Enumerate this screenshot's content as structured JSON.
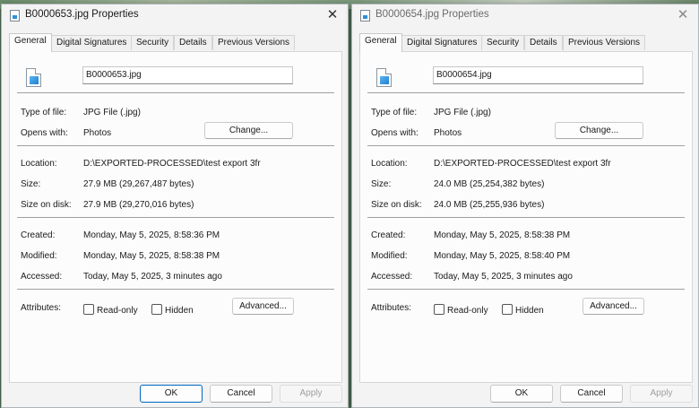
{
  "dialogs": [
    {
      "title": "B0000653.jpg Properties",
      "tabs": [
        "General",
        "Digital Signatures",
        "Security",
        "Details",
        "Previous Versions"
      ],
      "filename": "B0000653.jpg",
      "type_label": "Type of file:",
      "type_value": "JPG File (.jpg)",
      "opens_label": "Opens with:",
      "opens_value": "Photos",
      "change_label": "Change...",
      "location_label": "Location:",
      "location_value": "D:\\EXPORTED-PROCESSED\\test export 3fr",
      "size_label": "Size:",
      "size_value": "27.9 MB (29,267,487 bytes)",
      "size_disk_label": "Size on disk:",
      "size_disk_value": "27.9 MB (29,270,016 bytes)",
      "created_label": "Created:",
      "created_value": "Monday, May 5, 2025, 8:58:36 PM",
      "modified_label": "Modified:",
      "modified_value": "Monday, May 5, 2025, 8:58:38 PM",
      "accessed_label": "Accessed:",
      "accessed_value": "Today, May 5, 2025, 3 minutes ago",
      "attributes_label": "Attributes:",
      "readonly_label": "Read-only",
      "hidden_label": "Hidden",
      "advanced_label": "Advanced...",
      "ok_label": "OK",
      "cancel_label": "Cancel",
      "apply_label": "Apply",
      "close_glyph": "✕"
    },
    {
      "title": "B0000654.jpg Properties",
      "tabs": [
        "General",
        "Digital Signatures",
        "Security",
        "Details",
        "Previous Versions"
      ],
      "filename": "B0000654.jpg",
      "type_label": "Type of file:",
      "type_value": "JPG File (.jpg)",
      "opens_label": "Opens with:",
      "opens_value": "Photos",
      "change_label": "Change...",
      "location_label": "Location:",
      "location_value": "D:\\EXPORTED-PROCESSED\\test export 3fr",
      "size_label": "Size:",
      "size_value": "24.0 MB (25,254,382 bytes)",
      "size_disk_label": "Size on disk:",
      "size_disk_value": "24.0 MB (25,255,936 bytes)",
      "created_label": "Created:",
      "created_value": "Monday, May 5, 2025, 8:58:38 PM",
      "modified_label": "Modified:",
      "modified_value": "Monday, May 5, 2025, 8:58:40 PM",
      "accessed_label": "Accessed:",
      "accessed_value": "Today, May 5, 2025, 3 minutes ago",
      "attributes_label": "Attributes:",
      "readonly_label": "Read-only",
      "hidden_label": "Hidden",
      "advanced_label": "Advanced...",
      "ok_label": "OK",
      "cancel_label": "Cancel",
      "apply_label": "Apply",
      "close_glyph": "✕"
    }
  ],
  "colors": {
    "dialog_bg": "#f3f3f3",
    "panel_bg": "#fcfcfc",
    "primary_border": "#0067c0",
    "icon_blue": "#1e7ed0"
  },
  "icons": [
    "document-icon",
    "image-file-icon",
    "close-icon"
  ]
}
